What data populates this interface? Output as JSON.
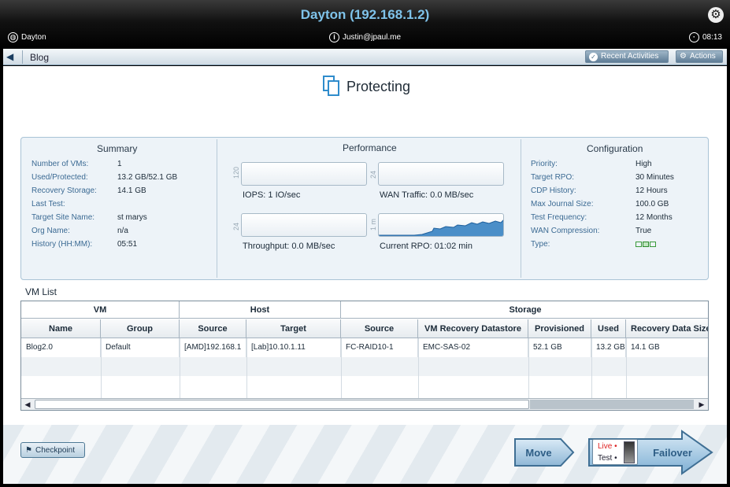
{
  "window": {
    "title": "Dayton (192.168.1.2)"
  },
  "infobar": {
    "site": "Dayton",
    "user": "Justin@jpaul.me",
    "time": "08:13"
  },
  "nav": {
    "crumb": "Blog",
    "recent_label": "Recent Activities",
    "actions_label": "Actions"
  },
  "status": {
    "label": "Protecting"
  },
  "summary": {
    "title": "Summary",
    "rows": [
      {
        "label": "Number of VMs:",
        "value": "1"
      },
      {
        "label": "Used/Protected:",
        "value": "13.2 GB/52.1 GB"
      },
      {
        "label": "Recovery Storage:",
        "value": "14.1 GB"
      },
      {
        "label": "Last Test:",
        "value": ""
      },
      {
        "label": "Target Site Name:",
        "value": "st marys"
      },
      {
        "label": "Org Name:",
        "value": "n/a"
      },
      {
        "label": "History (HH:MM):",
        "value": "05:51"
      }
    ]
  },
  "performance": {
    "title": "Performance",
    "graphs": [
      {
        "axis": "120",
        "label": "IOPS: 1 IO/sec"
      },
      {
        "axis": "24",
        "label": "WAN Traffic: 0.0 MB/sec"
      },
      {
        "axis": "24",
        "label": "Throughput: 0.0 MB/sec"
      },
      {
        "axis": "1 m",
        "label": "Current RPO: 01:02 min"
      }
    ]
  },
  "configuration": {
    "title": "Configuration",
    "rows": [
      {
        "label": "Priority:",
        "value": "High"
      },
      {
        "label": "Target RPO:",
        "value": "30 Minutes"
      },
      {
        "label": "CDP History:",
        "value": "12 Hours"
      },
      {
        "label": "Max Journal Size:",
        "value": "100.0 GB"
      },
      {
        "label": "Test Frequency:",
        "value": "12 Months"
      },
      {
        "label": "WAN Compression:",
        "value": "True"
      },
      {
        "label": "Type:",
        "value": ""
      }
    ]
  },
  "vm_list": {
    "title": "VM List",
    "groups": [
      "VM",
      "Host",
      "Storage"
    ],
    "columns": [
      "Name",
      "Group",
      "Source",
      "Target",
      "Source",
      "VM Recovery Datastore",
      "Provisioned",
      "Used",
      "Recovery Data Size"
    ],
    "rows": [
      [
        "Blog2.0",
        "Default",
        "[AMD]192.168.1",
        "[Lab]10.10.1.11",
        "FC-RAID10-1",
        "EMC-SAS-02",
        "52.1 GB",
        "13.2 GB",
        "14.1 GB"
      ]
    ]
  },
  "actions": {
    "checkpoint": "Checkpoint",
    "move": "Move",
    "failover": "Failover",
    "live": "Live",
    "test": "Test"
  }
}
